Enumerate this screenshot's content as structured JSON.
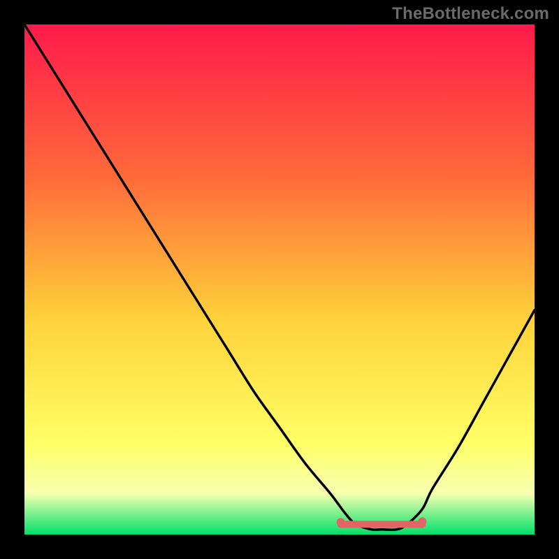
{
  "watermark": "TheBottleneck.com",
  "colors": {
    "gradient_top": "#ff1a4b",
    "gradient_mid1": "#ff6a3a",
    "gradient_mid2": "#ffd23a",
    "gradient_mid3": "#ffff66",
    "gradient_bottom": "#00e06a",
    "curve": "#000000",
    "marker": "#e06666",
    "frame": "#000000"
  },
  "chart_data": {
    "type": "line",
    "title": "",
    "xlabel": "",
    "ylabel": "",
    "xlim": [
      0,
      100
    ],
    "ylim": [
      0,
      100
    ],
    "series": [
      {
        "name": "bottleneck-curve",
        "x": [
          0,
          5,
          10,
          15,
          20,
          25,
          30,
          35,
          40,
          45,
          50,
          55,
          60,
          63,
          65,
          68,
          70,
          73,
          75,
          78,
          80,
          85,
          90,
          95,
          100
        ],
        "values": [
          100,
          92,
          84,
          76,
          68,
          60,
          52,
          44,
          36,
          28,
          21,
          14,
          8,
          4,
          2,
          1,
          1,
          1,
          2,
          5,
          9,
          17,
          26,
          35,
          44
        ]
      }
    ],
    "annotation": {
      "name": "optimal-range-marker",
      "x_start": 62,
      "x_end": 78,
      "y": 2
    },
    "legend": false,
    "grid": false
  }
}
